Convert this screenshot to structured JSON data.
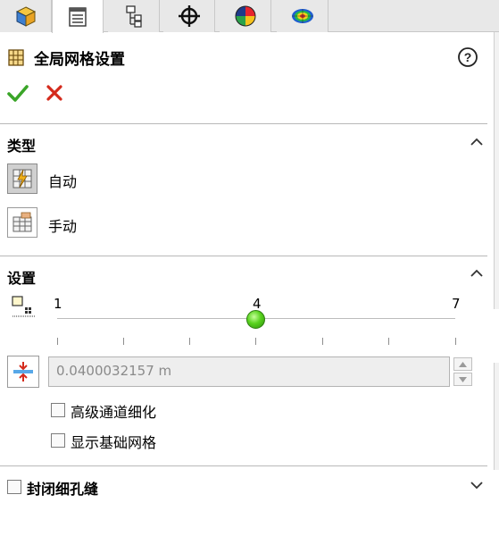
{
  "tabs": [
    {
      "name": "feature-manager",
      "icon": "part-cube-icon",
      "active": false
    },
    {
      "name": "property-manager",
      "icon": "property-list-icon",
      "active": true
    },
    {
      "name": "configuration-manager",
      "icon": "configuration-icon",
      "active": false
    },
    {
      "name": "dimxpert-manager",
      "icon": "crosshair-icon",
      "active": false
    },
    {
      "name": "display-manager",
      "icon": "appearance-sphere-icon",
      "active": false
    },
    {
      "name": "simulation-manager",
      "icon": "mesh-results-icon",
      "active": false
    }
  ],
  "panel": {
    "title": "全局网格设置",
    "help_icon": "help-icon",
    "ok_icon": "checkmark-icon",
    "cancel_icon": "close-x-icon"
  },
  "type_section": {
    "label": "类型",
    "options": [
      {
        "label": "自动",
        "icon": "auto-mesh-icon",
        "selected": true
      },
      {
        "label": "手动",
        "icon": "manual-mesh-icon",
        "selected": false
      }
    ]
  },
  "settings_section": {
    "label": "设置",
    "slider": {
      "min_label": "1",
      "value_label": "4",
      "max_label": "7",
      "min": 1,
      "max": 7,
      "value": 4
    },
    "min_gap_value": "0.0400032157 m",
    "checkboxes": [
      {
        "label": "高级通道细化",
        "checked": false
      },
      {
        "label": "显示基础网格",
        "checked": false
      }
    ]
  },
  "close_gaps_section": {
    "label": "封闭细孔缝",
    "checked": false,
    "collapsed": true
  },
  "colors": {
    "accept_green": "#3aa528",
    "cancel_red": "#d42a1c",
    "tab_bg": "#e8e8e8",
    "slider_thumb": "#58d21e"
  }
}
